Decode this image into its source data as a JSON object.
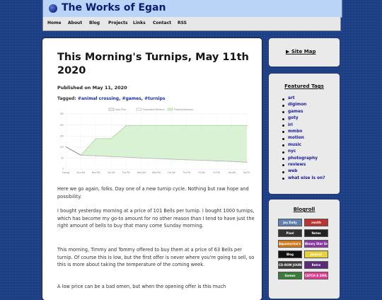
{
  "site": {
    "title": "The Works of Egan"
  },
  "nav": {
    "items": [
      "Home",
      "About",
      "Blog",
      "Projects",
      "Links",
      "Contact",
      "RSS"
    ]
  },
  "post": {
    "title": "This Morning's Turnips, May 11th 2020",
    "published": "Published on May 11, 2020",
    "tags_label": "Tagged:",
    "tags": [
      "#animal crossing",
      "#games",
      "#turnips"
    ],
    "paragraphs": [
      "Here we go again, folks. Day one of a new turnip cycle. Nothing but raw hope and possibility.",
      "I bought yesterday morning at a price of 101 Bells per turnip. I bought 1000 turnips, which has become my go-to amount for no other reason than I tend to have just the right amount of bells to buy that many come Sunday morning.",
      "This morning, Timmy and Tommy offered to buy them at a price of 63 Bells per turnip. Of course this is low, but the first offer is never where you're going to sell, so this is more about taking the temperature of the coming week.",
      "A low price can be a bad omen, but when the opening offer is this much"
    ]
  },
  "chart_data": {
    "type": "line",
    "legend": [
      "Input Price",
      "Guaranteed Minimum",
      "Potential Maximum"
    ],
    "legend_position": "top",
    "categories": [
      "Sunday",
      "Mon AM",
      "Mon PM",
      "Tue AM",
      "Tue PM",
      "Wed AM",
      "Wed PM",
      "Thu AM",
      "Thu PM",
      "Fri AM",
      "Fri PM",
      "Sat AM",
      "Sat PM"
    ],
    "yticks": [
      0,
      50,
      100,
      150,
      200,
      250
    ],
    "ylim": [
      0,
      250
    ],
    "grid": true,
    "series": [
      {
        "name": "Input Price",
        "values": [
          101,
          63,
          null,
          null,
          null,
          null,
          null,
          null,
          null,
          null,
          null,
          null,
          null
        ]
      },
      {
        "name": "Guaranteed Minimum",
        "values": [
          101,
          63,
          60,
          57,
          54,
          50,
          48,
          45,
          42,
          40,
          37,
          35,
          31
        ]
      },
      {
        "name": "Potential Maximum",
        "values": [
          101,
          63,
          138,
          138,
          197,
          197,
          197,
          197,
          197,
          197,
          197,
          197,
          197
        ]
      }
    ],
    "colors": {
      "input": "#8a8a8a",
      "min": "#b0b0b0",
      "max_fill": "#d9f2d3",
      "max_line": "#a4d898"
    }
  },
  "sidebar": {
    "sitemap": "Site Map",
    "featured_tags_title": "Featured Tags",
    "featured_tags": [
      "art",
      "digimon",
      "games",
      "goty",
      "irl",
      "mmbn",
      "motion",
      "music",
      "nyc",
      "photography",
      "reviews",
      "web",
      "what else is on?"
    ],
    "blogroll_title": "Blogroll",
    "blogroll": [
      {
        "label": "Joy Daily",
        "bg": "#5f7fb0"
      },
      {
        "label": "zenith",
        "bg": "#b33"
      },
      {
        "label": "Pixel",
        "bg": "#333"
      },
      {
        "label": "Notes",
        "bg": "#222"
      },
      {
        "label": "Aquamarine's Blog",
        "bg": "#d27a1e"
      },
      {
        "label": "Binary Star Games",
        "bg": "#8a3aa4"
      },
      {
        "label": "Blog",
        "bg": "#111"
      },
      {
        "label": "Journal",
        "bg": "#e8d13a"
      },
      {
        "label": "CD-ROM JOURNAL",
        "bg": "#3c3c3c"
      },
      {
        "label": "Retro",
        "bg": "#5a2c7a"
      },
      {
        "label": "Games",
        "bg": "#3a7a3a"
      },
      {
        "label": "CATCH A SMILE",
        "bg": "#e23b8f"
      }
    ]
  }
}
